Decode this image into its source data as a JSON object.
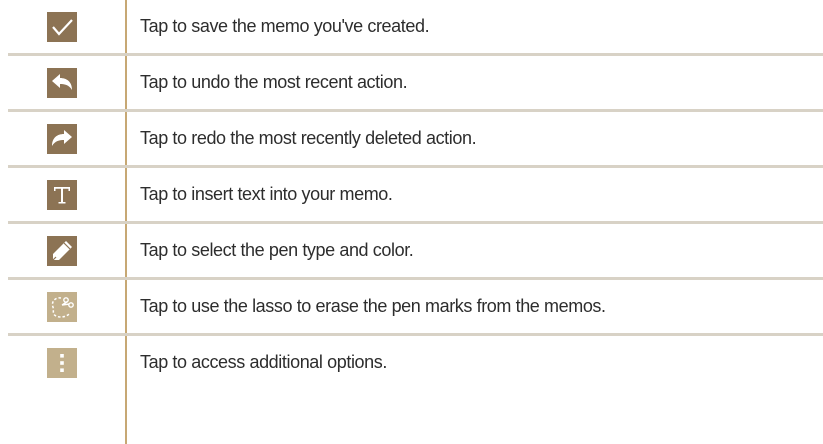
{
  "rows": [
    {
      "icon": "checkmark-icon",
      "description": "Tap to save the memo you've created."
    },
    {
      "icon": "undo-icon",
      "description": "Tap to undo the most recent action."
    },
    {
      "icon": "redo-icon",
      "description": "Tap to redo the most recently deleted action."
    },
    {
      "icon": "text-icon",
      "description": "Tap to insert text into your memo."
    },
    {
      "icon": "pen-icon",
      "description": "Tap to select the pen type and color."
    },
    {
      "icon": "lasso-eraser-icon",
      "description": "Tap to use the lasso to erase the pen marks from the memos."
    },
    {
      "icon": "more-options-icon",
      "description": "Tap to access additional options."
    }
  ],
  "colors": {
    "icon_background": "#8c7354",
    "divider": "#c7a874",
    "row_separator": "#d8d2c6",
    "text": "#2d2d2d"
  }
}
